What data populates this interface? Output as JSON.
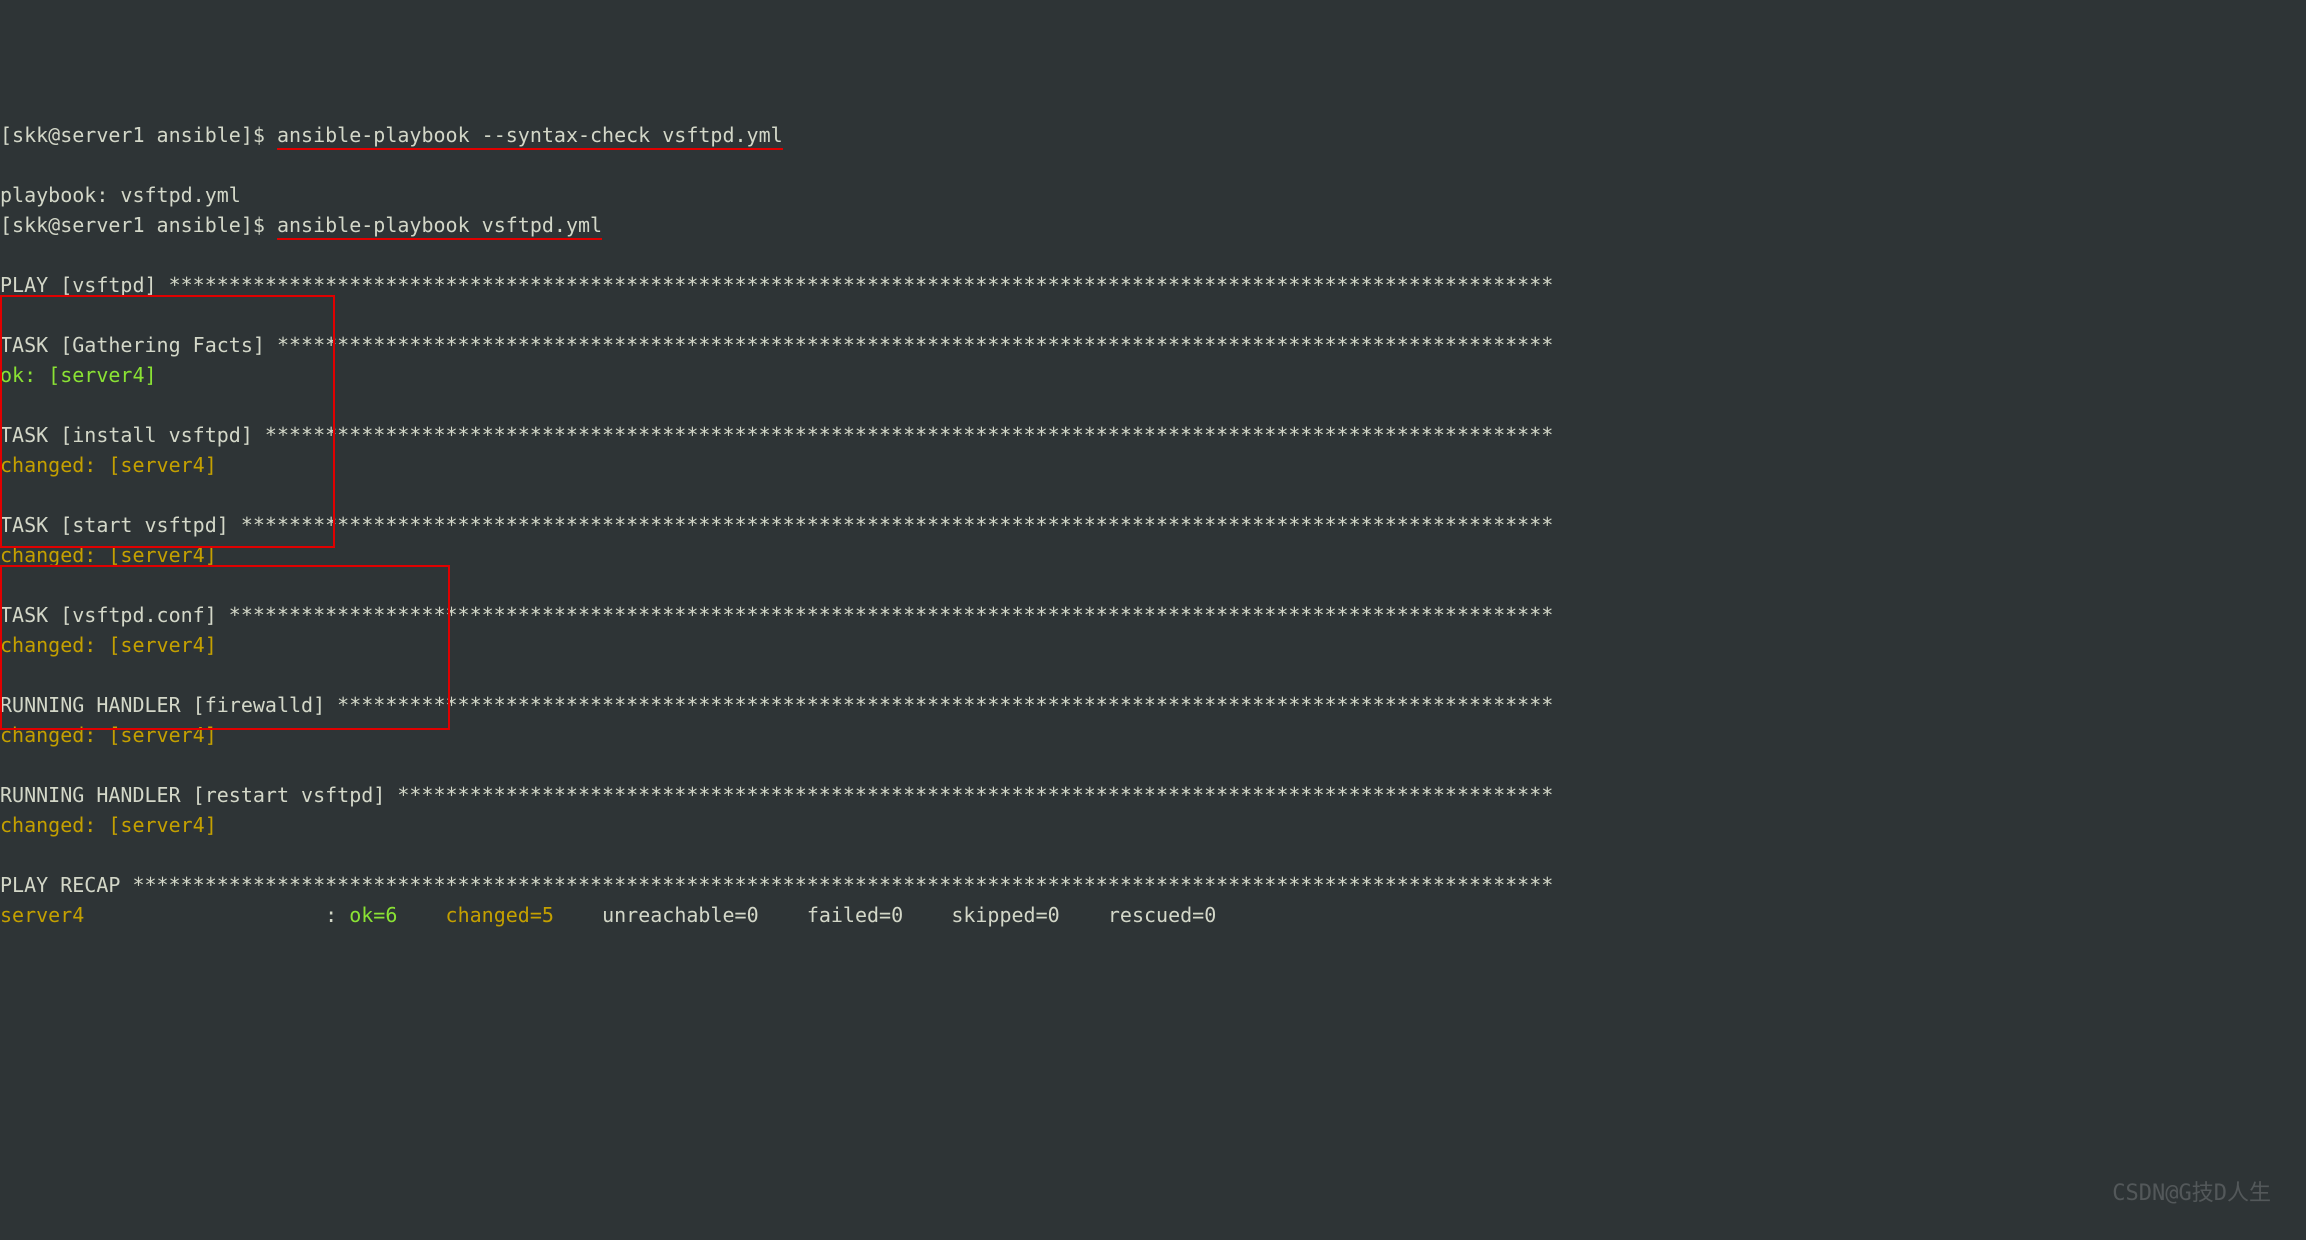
{
  "prompt1": {
    "user_host_path": "[skk@server1 ansible]$ ",
    "command": "ansible-playbook --syntax-check vsftpd.yml"
  },
  "output1": {
    "playbook_line": "playbook: vsftpd.yml"
  },
  "prompt2": {
    "user_host_path": "[skk@server1 ansible]$ ",
    "command": "ansible-playbook vsftpd.yml"
  },
  "play_header": "PLAY [vsftpd] *******************************************************************************************************************",
  "task_gather": "TASK [Gathering Facts] **********************************************************************************************************",
  "task_gather_result": "ok: [server4]",
  "task_install": "TASK [install vsftpd] ***********************************************************************************************************",
  "task_install_result": "changed: [server4]",
  "task_start": "TASK [start vsftpd] *************************************************************************************************************",
  "task_start_result": "changed: [server4]",
  "task_conf": "TASK [vsftpd.conf] **************************************************************************************************************",
  "task_conf_result": "changed: [server4]",
  "handler_firewalld": "RUNNING HANDLER [firewalld] *****************************************************************************************************",
  "handler_firewalld_result": "changed: [server4]",
  "handler_restart": "RUNNING HANDLER [restart vsftpd] ************************************************************************************************",
  "handler_restart_result": "changed: [server4]",
  "recap_header": "PLAY RECAP **********************************************************************************************************************",
  "recap": {
    "host": "server4",
    "pad": "                   ",
    "sep": " : ",
    "ok": "ok=6",
    "changed": "changed=5",
    "unreachable": "unreachable=0",
    "failed": "failed=0",
    "skipped": "skipped=0",
    "rescued": "rescued=0",
    "sp": "    "
  },
  "watermark": "CSDN@G技D人生"
}
